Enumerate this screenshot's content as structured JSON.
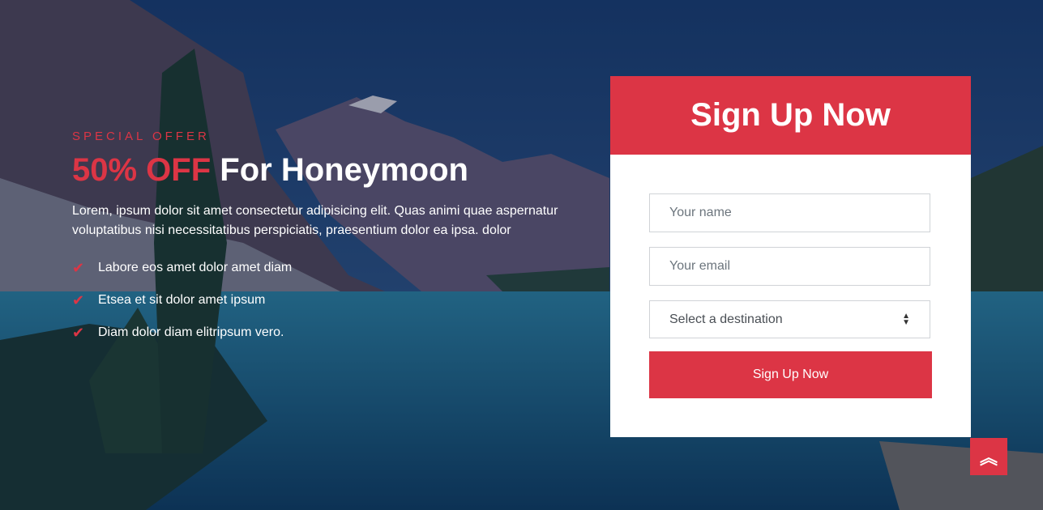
{
  "offer": {
    "eyebrow": "SPECIAL OFFER",
    "accent": "50% OFF",
    "title": " For Honeymoon",
    "description": "Lorem, ipsum dolor sit amet consectetur adipisicing elit. Quas animi quae aspernatur voluptatibus nisi necessitatibus perspiciatis, praesentium dolor ea ipsa. dolor",
    "features": [
      "Labore eos amet dolor amet diam",
      "Etsea et sit dolor amet ipsum",
      "Diam dolor diam elitripsum vero."
    ]
  },
  "signup": {
    "title": "Sign Up Now",
    "name_placeholder": "Your name",
    "email_placeholder": "Your email",
    "destination_selected": "Select a destination",
    "submit_label": "Sign Up Now"
  },
  "icons": {
    "check": "check-icon",
    "back_to_top": "double-chevron-up-icon"
  },
  "colors": {
    "accent": "#dc3545",
    "card_bg": "#ffffff"
  }
}
